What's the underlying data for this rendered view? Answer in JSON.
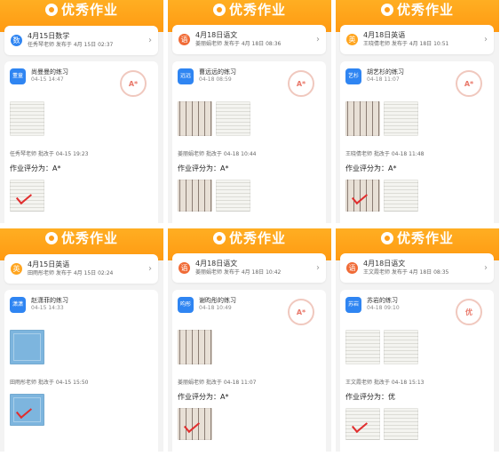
{
  "app": {
    "brand_name": "优秀作业"
  },
  "colors": {
    "brand_orange": "#ff9d18",
    "math_blue": "#2f85f2",
    "chinese_red": "#f06a35",
    "english_orange": "#ffa51f",
    "stamp_red": "#e76a5a"
  },
  "panels": [
    {
      "subject_badge": "数",
      "assignment_title": "4月15日数学",
      "assignment_meta": "任秀琴老师  发布于 4月 15日 02:37",
      "student_avatar": "董童",
      "student_title": "尚曼曼的练习",
      "student_date": "04-15 14:47",
      "stamp_text": "A*",
      "review": "任秀琴老师  批改于 04-15 19:23",
      "grade": "作业评分为：A*"
    },
    {
      "subject_badge": "语",
      "assignment_title": "4月18日语文",
      "assignment_meta": "姜丽娟老师  发布于 4月 18日 08:36",
      "student_avatar": "远远",
      "student_title": "曹远远的练习",
      "student_date": "04-18 08:59",
      "stamp_text": "A*",
      "review": "姜丽娟老师  批改于 04-18 10:44",
      "grade": "作业评分为：A*"
    },
    {
      "subject_badge": "英",
      "assignment_title": "4月18日英语",
      "assignment_meta": "王晓倩老师  发布于 4月 18日 10:51",
      "student_avatar": "艺杉",
      "student_title": "胡艺杉的练习",
      "student_date": "04-18 11:07",
      "stamp_text": "A*",
      "review": "王晓倩老师  批改于 04-18 11:48",
      "grade": "作业评分为：A*"
    },
    {
      "subject_badge": "英",
      "assignment_title": "4月15日英语",
      "assignment_meta": "田雨彤老师  发布于 4月 15日 02:24",
      "student_avatar": "潇潇",
      "student_title": "赵潇菲的练习",
      "student_date": "04-15 14:33",
      "stamp_text": "",
      "review": "田雨彤老师  批改于 04-15 15:50",
      "grade": ""
    },
    {
      "subject_badge": "语",
      "assignment_title": "4月18日语文",
      "assignment_meta": "姜丽娟老师  发布于 4月 18日 10:42",
      "student_avatar": "昀彤",
      "student_title": "谢昀彤的练习",
      "student_date": "04-18 10:49",
      "stamp_text": "A*",
      "review": "姜丽娟老师  批改于 04-18 11:07",
      "grade": "作业评分为：A*"
    },
    {
      "subject_badge": "语",
      "assignment_title": "4月18日语文",
      "assignment_meta": "王文霞老师  发布于 4月 18日 08:35",
      "student_avatar": "苏岩",
      "student_title": "苏岩的练习",
      "student_date": "04-18 09:10",
      "stamp_text": "优",
      "review": "王文霞老师  批改于 04-18 15:13",
      "grade": "作业评分为：优"
    }
  ]
}
